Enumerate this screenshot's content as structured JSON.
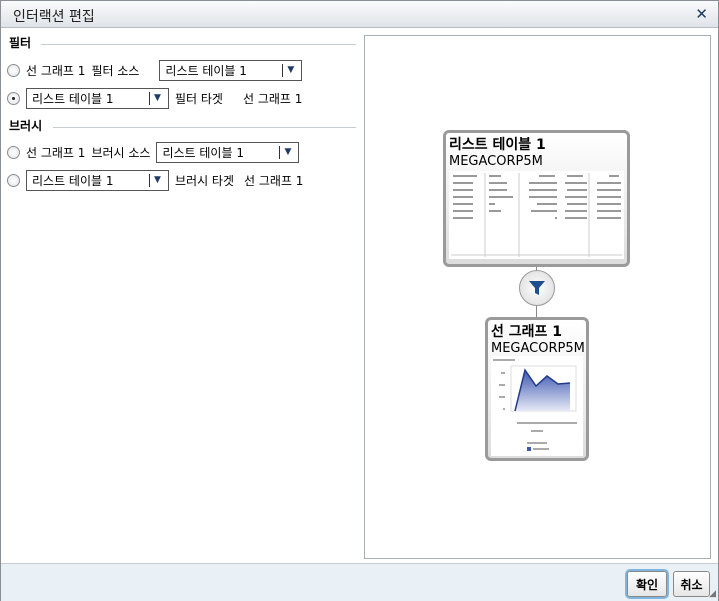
{
  "dialog": {
    "title": "인터랙션 편집",
    "close_icon": "close-icon"
  },
  "filter": {
    "heading": "필터",
    "row1": {
      "selected": false,
      "label": "선 그래프 1",
      "role": "필터 소스",
      "select_value": "리스트 테이블 1"
    },
    "row2": {
      "selected": true,
      "select_value": "리스트 테이블 1",
      "role": "필터 타겟",
      "label": "선 그래프 1"
    }
  },
  "brush": {
    "heading": "브러시",
    "row1": {
      "selected": false,
      "label": "선 그래프 1",
      "role": "브러시 소스",
      "select_value": "리스트 테이블 1"
    },
    "row2": {
      "selected": false,
      "select_value": "리스트 테이블 1",
      "role": "브러시 타겟",
      "label": "선 그래프 1"
    }
  },
  "preview": {
    "source": {
      "title": "리스트 테이블 1",
      "subtitle": "MEGACORP5M"
    },
    "target": {
      "title": "선 그래프 1",
      "subtitle": "MEGACORP5M"
    },
    "link_icon": "filter-funnel-icon"
  },
  "footer": {
    "ok": "확인",
    "cancel": "취소"
  }
}
